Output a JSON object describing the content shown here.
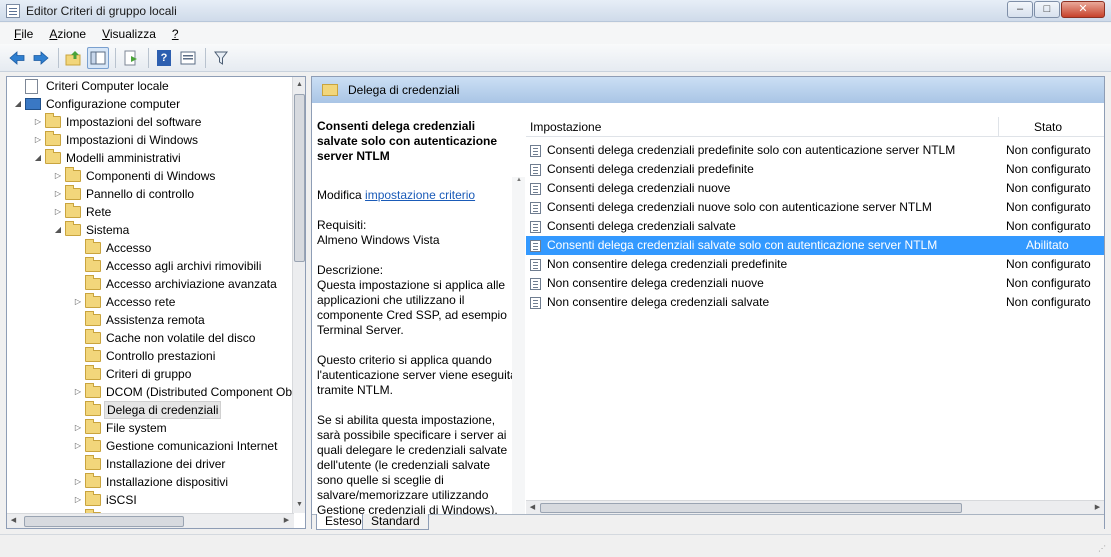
{
  "window": {
    "title": "Editor Criteri di gruppo locali",
    "minimize": "–",
    "maximize": "□",
    "close": "✕"
  },
  "menu": [
    {
      "label": "File",
      "accel": "F",
      "rest": "ile"
    },
    {
      "label": "Azione",
      "accel": "A",
      "rest": "zione"
    },
    {
      "label": "Visualizza",
      "accel": "V",
      "rest": "isualizza"
    },
    {
      "label": "?",
      "accel": "?",
      "rest": ""
    }
  ],
  "toolbar": {
    "back_icon": "arrow-left-icon",
    "forward_icon": "arrow-right-icon",
    "up_icon": "folder-up-icon",
    "show_tree_icon": "show-hide-tree-icon",
    "export_icon": "export-list-icon",
    "help_icon": "help-icon",
    "properties_icon": "properties-icon",
    "filter_icon": "filter-icon"
  },
  "tree": [
    {
      "label": "Criteri Computer locale",
      "type": "doc",
      "level": 0,
      "expander": ""
    },
    {
      "label": "Configurazione computer",
      "type": "pc",
      "level": 0,
      "expander": "◢"
    },
    {
      "label": "Impostazioni del software",
      "type": "folder",
      "level": 1,
      "expander": "▷"
    },
    {
      "label": "Impostazioni di Windows",
      "type": "folder",
      "level": 1,
      "expander": "▷"
    },
    {
      "label": "Modelli amministrativi",
      "type": "folder",
      "level": 1,
      "expander": "◢"
    },
    {
      "label": "Componenti di Windows",
      "type": "folder",
      "level": 2,
      "expander": "▷"
    },
    {
      "label": "Pannello di controllo",
      "type": "folder",
      "level": 2,
      "expander": "▷"
    },
    {
      "label": "Rete",
      "type": "folder",
      "level": 2,
      "expander": "▷"
    },
    {
      "label": "Sistema",
      "type": "folder",
      "level": 2,
      "expander": "◢"
    },
    {
      "label": "Accesso",
      "type": "folder",
      "level": 3,
      "expander": ""
    },
    {
      "label": "Accesso agli archivi rimovibili",
      "type": "folder",
      "level": 3,
      "expander": ""
    },
    {
      "label": "Accesso archiviazione avanzata",
      "type": "folder",
      "level": 3,
      "expander": ""
    },
    {
      "label": "Accesso rete",
      "type": "folder",
      "level": 3,
      "expander": "▷"
    },
    {
      "label": "Assistenza remota",
      "type": "folder",
      "level": 3,
      "expander": ""
    },
    {
      "label": "Cache non volatile del disco",
      "type": "folder",
      "level": 3,
      "expander": ""
    },
    {
      "label": "Controllo prestazioni",
      "type": "folder",
      "level": 3,
      "expander": ""
    },
    {
      "label": "Criteri di gruppo",
      "type": "folder",
      "level": 3,
      "expander": ""
    },
    {
      "label": "DCOM (Distributed Component Ob",
      "type": "folder",
      "level": 3,
      "expander": "▷"
    },
    {
      "label": "Delega di credenziali",
      "type": "folder",
      "level": 3,
      "expander": "",
      "selected": true
    },
    {
      "label": "File system",
      "type": "folder",
      "level": 3,
      "expander": "▷"
    },
    {
      "label": "Gestione comunicazioni Internet",
      "type": "folder",
      "level": 3,
      "expander": "▷"
    },
    {
      "label": "Installazione dei driver",
      "type": "folder",
      "level": 3,
      "expander": ""
    },
    {
      "label": "Installazione dispositivi",
      "type": "folder",
      "level": 3,
      "expander": "▷"
    },
    {
      "label": "iSCSI",
      "type": "folder",
      "level": 3,
      "expander": "▷"
    },
    {
      "label": "Kerb",
      "type": "folder",
      "level": 3,
      "expander": ""
    }
  ],
  "header": {
    "title": "Delega di credenziali"
  },
  "description": {
    "title": "Consenti delega credenziali salvate solo con autenticazione server NTLM",
    "edit_prefix": "Modifica ",
    "edit_link": "impostazione criterio",
    "requirements_label": "Requisiti:",
    "requirements_value": "Almeno Windows Vista",
    "description_label": "Descrizione:",
    "paragraph1": "Questa impostazione si applica alle applicazioni che utilizzano il componente Cred SSP, ad esempio Terminal Server.",
    "paragraph2": "Questo criterio si applica quando l'autenticazione server viene eseguita tramite NTLM.",
    "paragraph3": "Se si abilita questa impostazione, sarà possibile specificare i server ai quali delegare le credenziali salvate dell'utente (le credenziali salvate sono quelle si sceglie di salvare/memorizzare utilizzando Gestione credenziali di Windows)."
  },
  "list": {
    "col_setting": "Impostazione",
    "col_state": "Stato",
    "rows": [
      {
        "name": "Consenti delega credenziali predefinite solo con autenticazione server NTLM",
        "state": "Non configurato"
      },
      {
        "name": "Consenti delega credenziali predefinite",
        "state": "Non configurato"
      },
      {
        "name": "Consenti delega credenziali nuove",
        "state": "Non configurato"
      },
      {
        "name": "Consenti delega credenziali nuove solo con autenticazione server NTLM",
        "state": "Non configurato"
      },
      {
        "name": "Consenti delega credenziali salvate",
        "state": "Non configurato"
      },
      {
        "name": "Consenti delega credenziali salvate solo con autenticazione server NTLM",
        "state": "Abilitato",
        "selected": true
      },
      {
        "name": "Non consentire delega credenziali predefinite",
        "state": "Non configurato"
      },
      {
        "name": "Non consentire delega credenziali nuove",
        "state": "Non configurato"
      },
      {
        "name": "Non consentire delega credenziali salvate",
        "state": "Non configurato"
      }
    ]
  },
  "tabs": [
    {
      "label": "Esteso",
      "active": true
    },
    {
      "label": "Standard",
      "active": false
    }
  ],
  "colors": {
    "selection": "#3399ff",
    "header_band": "#b7cfe9",
    "link": "#1a5bb8"
  }
}
